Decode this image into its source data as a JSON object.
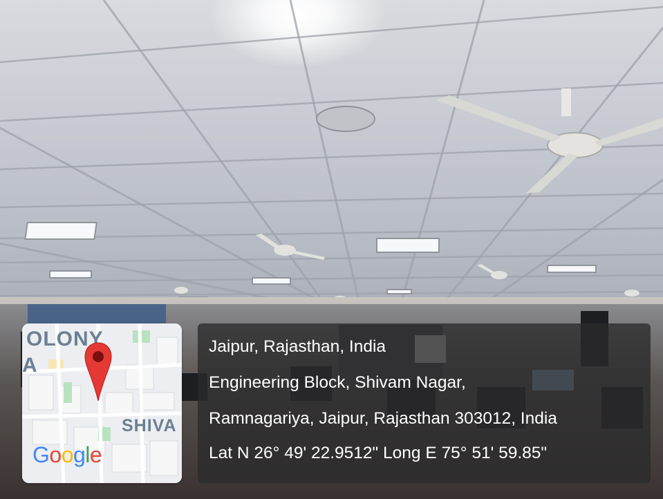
{
  "photo": {
    "subject": "ceiling-with-fans-lights-and-computer-lab"
  },
  "map": {
    "labels": [
      "OLONY",
      "A",
      "SHIVA"
    ],
    "logo": [
      "G",
      "o",
      "o",
      "g",
      "l",
      "e"
    ],
    "logo_colors": [
      "#4285F4",
      "#EA4335",
      "#FBBC05",
      "#4285F4",
      "#34A853",
      "#EA4335"
    ],
    "pin_color": "#EA4335"
  },
  "location": {
    "city": "Jaipur, Rajasthan, India",
    "address_line1": "Engineering Block, Shivam Nagar,",
    "address_line2": "Ramnagariya, Jaipur, Rajasthan 303012, India",
    "coordinates": "Lat N 26° 49' 22.9512\" Long E 75° 51' 59.85\""
  }
}
